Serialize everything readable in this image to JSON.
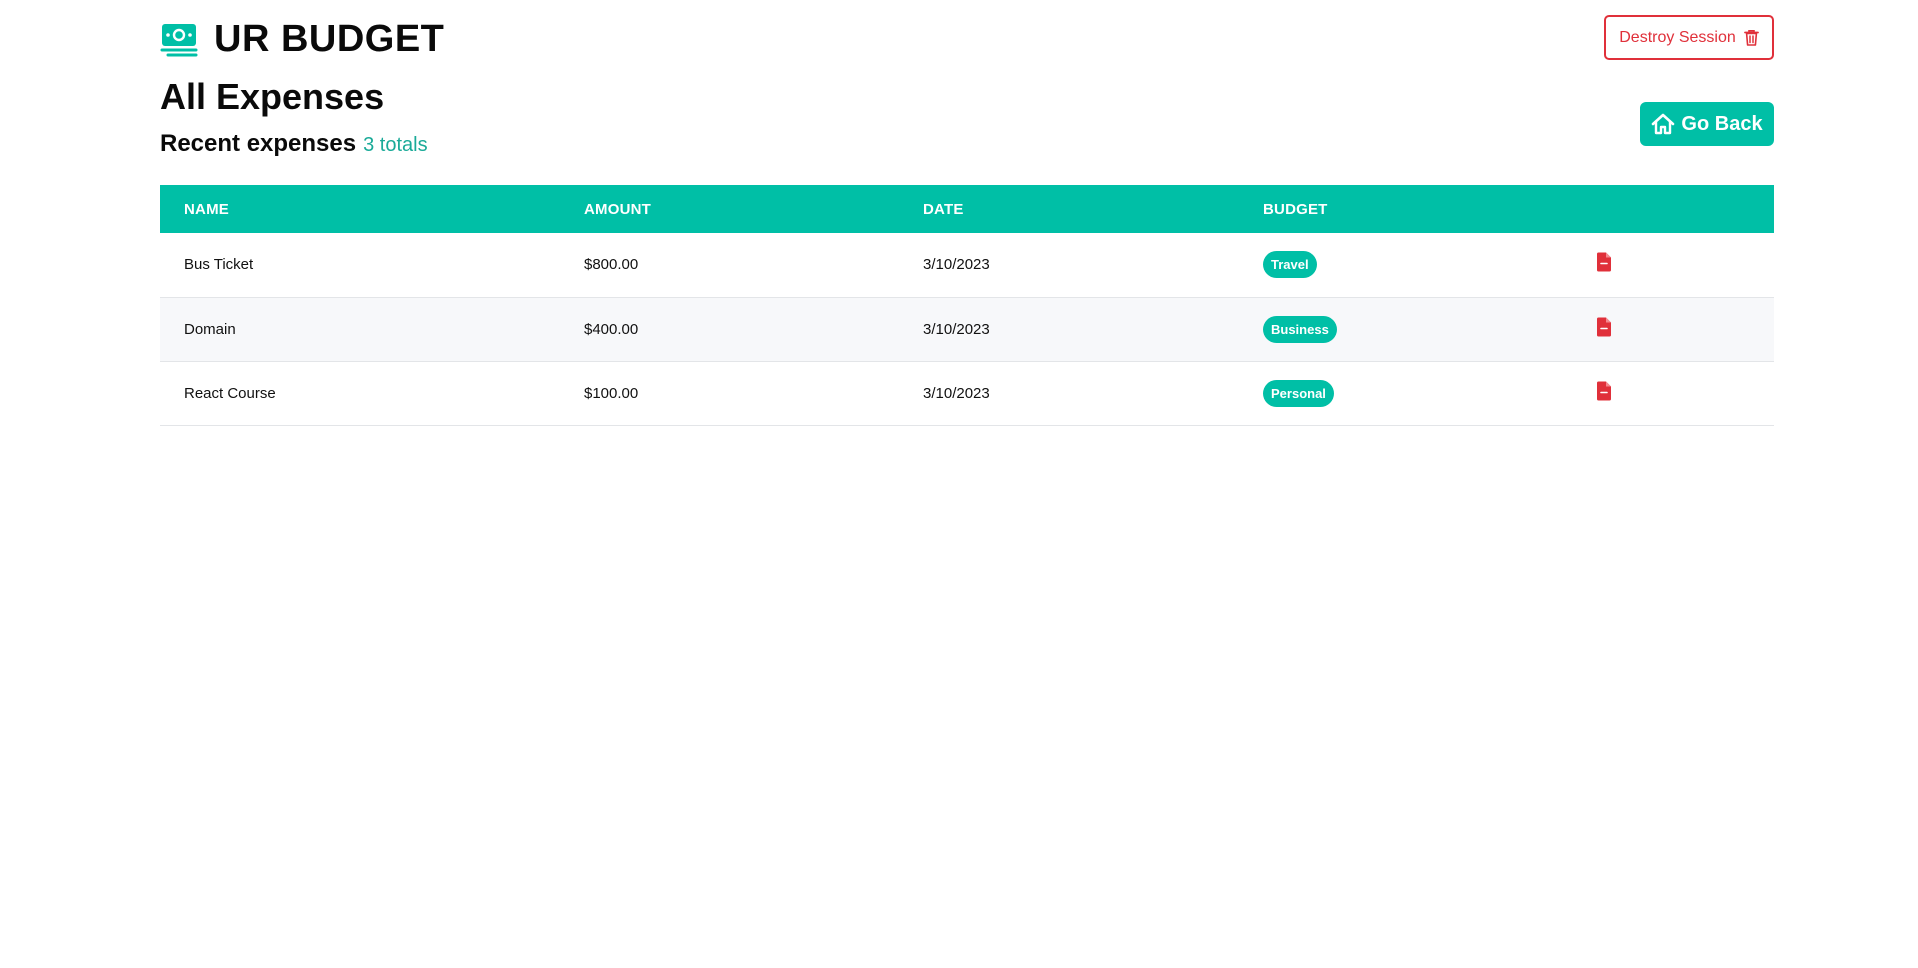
{
  "colors": {
    "accent": "#00bfa6",
    "danger": "#e0303a",
    "count_text": "#1aaa98",
    "row_alt": "#f7f8fa"
  },
  "header": {
    "brand_icon": "money-bill-icon",
    "brand_title": "UR BUDGET",
    "destroy_label": "Destroy Session",
    "destroy_icon": "trash-icon"
  },
  "main": {
    "title": "All Expenses",
    "subheading": "Recent expenses",
    "count_label": "3 totals",
    "back_label": "Go Back",
    "back_icon": "home-icon"
  },
  "table": {
    "columns": [
      "NAME",
      "AMOUNT",
      "DATE",
      "BUDGET",
      ""
    ],
    "rows": [
      {
        "name": "Bus Ticket",
        "amount": "$800.00",
        "date": "3/10/2023",
        "budget": "Travel",
        "action_icon": "file-delete-icon"
      },
      {
        "name": "Domain",
        "amount": "$400.00",
        "date": "3/10/2023",
        "budget": "Business",
        "action_icon": "file-delete-icon"
      },
      {
        "name": "React Course",
        "amount": "$100.00",
        "date": "3/10/2023",
        "budget": "Personal",
        "action_icon": "file-delete-icon"
      }
    ]
  }
}
